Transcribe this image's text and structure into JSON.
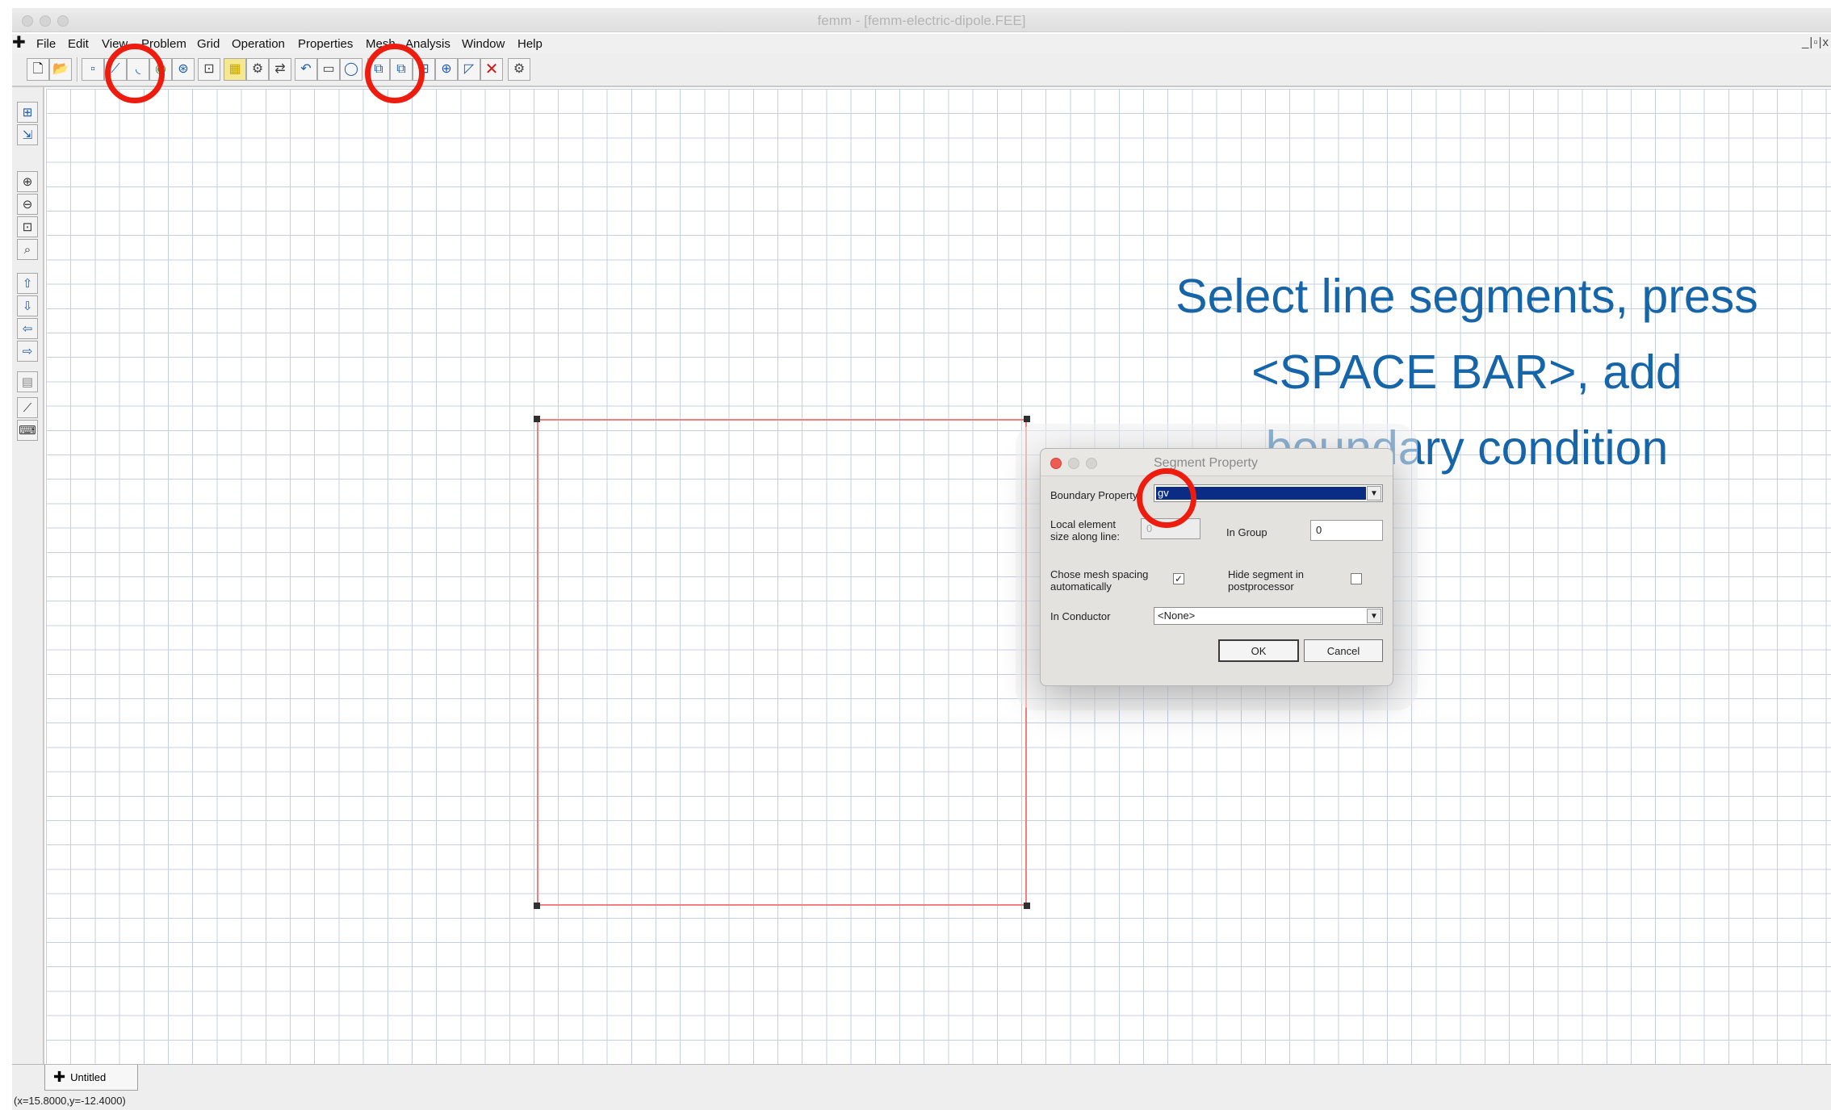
{
  "window": {
    "title": "femm - [femm-electric-dipole.FEE]",
    "mdi_controls": "_|▫|x"
  },
  "menu": {
    "logo_icon": "femm-cross-icon",
    "items": [
      "File",
      "Edit",
      "View",
      "Problem",
      "Grid",
      "Operation",
      "Properties",
      "Mesh",
      "Analysis",
      "Window",
      "Help"
    ]
  },
  "instruction": {
    "line1": "Select line segments, press",
    "line2": "<SPACE BAR>, add",
    "line3": "boundary condition",
    "color": "#1565a8"
  },
  "highlight_color": "#ee1c0e",
  "dialog": {
    "title": "Segment Property",
    "boundary_label": "Boundary Property",
    "boundary_value": "gv",
    "local_size_label_1": "Local element",
    "local_size_label_2": "size along line:",
    "local_size_value": "0",
    "group_label": "In Group",
    "group_value": "0",
    "mesh_auto_label_1": "Chose mesh spacing",
    "mesh_auto_label_2": "automatically",
    "mesh_auto_checked": "✓",
    "hide_label_1": "Hide segment in",
    "hide_label_2": "postprocessor",
    "conductor_label": "In Conductor",
    "conductor_value": "<None>",
    "ok_label": "OK",
    "cancel_label": "Cancel"
  },
  "tab": {
    "label": "Untitled"
  },
  "status": {
    "coords": "(x=15.8000,y=-12.4000)"
  }
}
